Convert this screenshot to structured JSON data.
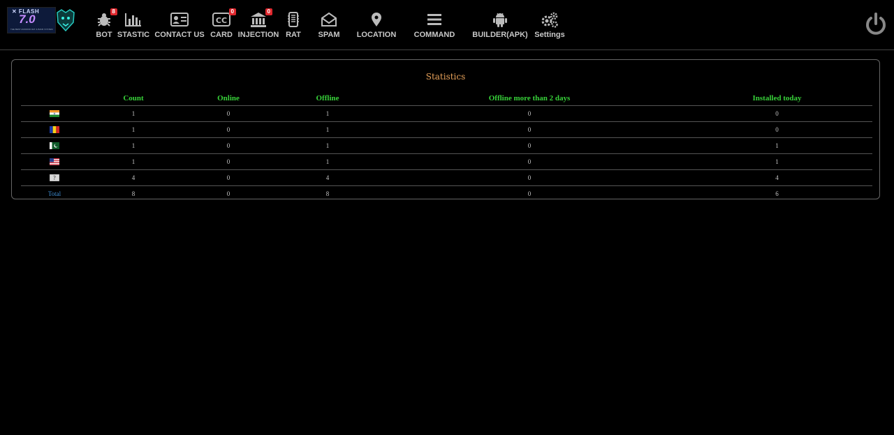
{
  "header": {
    "logo": {
      "line1": "✕ FLASH",
      "line2": "7.0",
      "line3": "THE BEST ANDROID RAT & BANK SYSTEM"
    },
    "nav": [
      {
        "label": "BOT",
        "icon": "bug-icon",
        "badge": "8"
      },
      {
        "label": "STASTIC",
        "icon": "bar-chart-icon"
      },
      {
        "label": "CONTACT US",
        "icon": "contact-card-icon"
      },
      {
        "label": "CARD",
        "icon": "credit-card-icon",
        "badge": "0"
      },
      {
        "label": "INJECTION",
        "icon": "bank-icon",
        "badge": "0"
      },
      {
        "label": "RAT",
        "icon": "phone-icon"
      },
      {
        "label": "SPAM",
        "icon": "envelope-icon"
      },
      {
        "label": "LOCATION",
        "icon": "map-pin-icon"
      },
      {
        "label": "COMMAND",
        "icon": "menu-icon"
      },
      {
        "label": "BUILDER(APK)",
        "icon": "android-icon"
      },
      {
        "label": "Settings",
        "icon": "gears-icon"
      }
    ]
  },
  "stats": {
    "title": "Statistics",
    "columns": [
      "",
      "Count",
      "Online",
      "Offline",
      "Offline more than 2 days",
      "Installed today"
    ],
    "rows": [
      {
        "flag": "india",
        "count": "1",
        "online": "0",
        "offline": "1",
        "offline2": "0",
        "today": "0"
      },
      {
        "flag": "romania",
        "count": "1",
        "online": "0",
        "offline": "1",
        "offline2": "0",
        "today": "0"
      },
      {
        "flag": "pakistan",
        "count": "1",
        "online": "0",
        "offline": "1",
        "offline2": "0",
        "today": "1"
      },
      {
        "flag": "usa",
        "count": "1",
        "online": "0",
        "offline": "1",
        "offline2": "0",
        "today": "1"
      },
      {
        "flag": "unknown",
        "count": "4",
        "online": "0",
        "offline": "4",
        "offline2": "0",
        "today": "4"
      }
    ],
    "total": {
      "label": "Total",
      "count": "8",
      "online": "0",
      "offline": "8",
      "offline2": "0",
      "today": "6"
    }
  }
}
